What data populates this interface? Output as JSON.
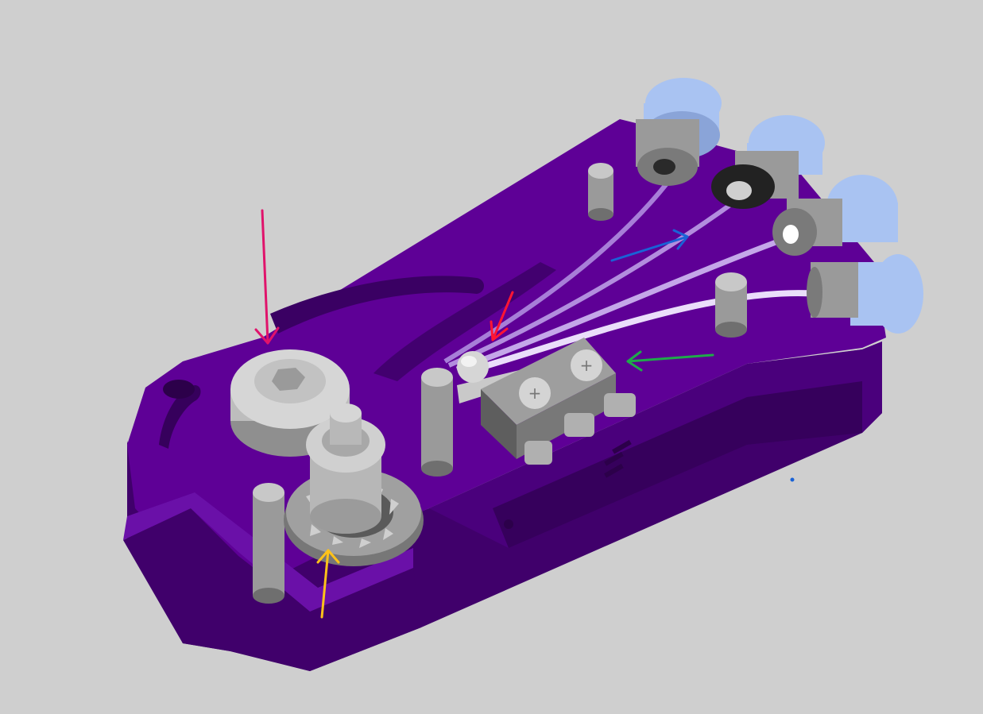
{
  "scene": {
    "background": "#cfcfcf",
    "body_color": "#5e0096",
    "body_dark": "#40006b",
    "body_darker": "#2c004a",
    "body_light": "#7a1fc0",
    "metal": "#c8c8c8",
    "metal_dark": "#8f8f8f",
    "metal_shadow": "#5c5c5c",
    "fitting_blue": "#a9c3f2",
    "fitting_blue_dark": "#5f74a3",
    "tube": "#e8e0ff"
  },
  "parts": {
    "pulley": "hex-socket-pulley",
    "gear": "slotted-encoder-gear",
    "switch": "micro-switch",
    "bearing_ball": "switch-roller-ball",
    "fittings": [
      "fitting-1",
      "fitting-2",
      "fitting-3",
      "fitting-4"
    ],
    "pins": [
      "pin-top",
      "pin-right",
      "pin-center",
      "pin-front"
    ]
  },
  "annotations": [
    {
      "name": "magenta-arrow",
      "color": "#e0136b"
    },
    {
      "name": "red-arrow",
      "color": "#ff1533"
    },
    {
      "name": "blue-arrow",
      "color": "#1a62d6"
    },
    {
      "name": "green-arrow",
      "color": "#1faa4a"
    },
    {
      "name": "yellow-arrow",
      "color": "#ffc21a"
    }
  ],
  "marker_dot": {
    "color": "#1a62d6"
  }
}
